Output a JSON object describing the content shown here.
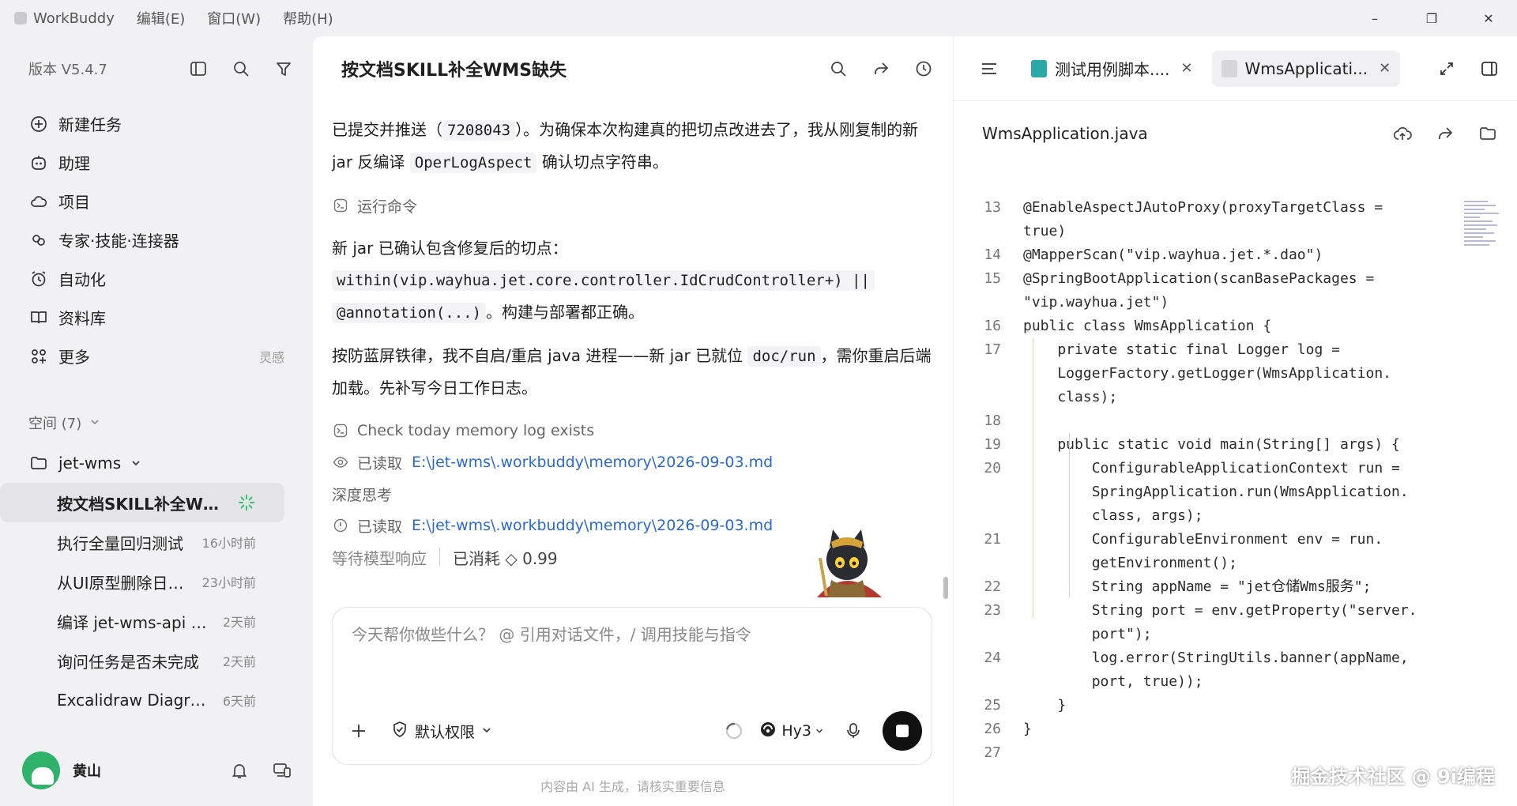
{
  "titlebar": {
    "app_name": "WorkBuddy",
    "menus": [
      "编辑(E)",
      "窗口(W)",
      "帮助(H)"
    ],
    "minimize": "–",
    "restore": "❐",
    "close": "✕"
  },
  "sidebar": {
    "version": "版本 V5.4.7",
    "nav": [
      {
        "label": "新建任务",
        "icon": "plus-circle-icon"
      },
      {
        "label": "助理",
        "icon": "robot-icon"
      },
      {
        "label": "项目",
        "icon": "cloud-icon"
      },
      {
        "label": "专家·技能·连接器",
        "icon": "expert-icon"
      },
      {
        "label": "自动化",
        "icon": "alarm-icon"
      },
      {
        "label": "资料库",
        "icon": "book-icon"
      },
      {
        "label": "更多",
        "icon": "grid-icon",
        "tail": "灵感"
      }
    ],
    "space_label": "空间 (7)",
    "project": "jet-wms",
    "tasks": [
      {
        "label": "按文档SKILL补全WMS...",
        "time": ""
      },
      {
        "label": "执行全量回归测试",
        "time": "16小时前"
      },
      {
        "label": "从UI原型删除日志...",
        "time": "23小时前"
      },
      {
        "label": "编译 jet-wms-api 后...",
        "time": "2天前"
      },
      {
        "label": "询问任务是否未完成",
        "time": "2天前"
      },
      {
        "label": "Excalidraw Diagram ...",
        "time": "6天前"
      }
    ],
    "user": "黄山"
  },
  "chat": {
    "title": "按文档SKILL补全WMS缺失",
    "msg1_a": "已提交并推送（",
    "msg1_commit": "7208043",
    "msg1_b": "）。为确保本次构建真的把切点改进去了，我从刚复制的新 jar 反编译 ",
    "msg1_class": "OperLogAspect",
    "msg1_c": " 确认切点字符串。",
    "step_run": "运行命令",
    "msg2_a": "新 jar 已确认包含修复后的切点：",
    "msg2_code1": "within(vip.wayhua.jet.core.controller.IdCrudController+) ||",
    "msg2_code2": "@annotation(...)",
    "msg2_b": "。构建与部署都正确。",
    "msg3_a": "按防蓝屏铁律，我不自启/重启 java 进程——新 jar 已就位 ",
    "msg3_path": "doc/run",
    "msg3_b": "，需你重启后端加载。先补写今日工作日志。",
    "step_check": "Check today memory log exists",
    "read_label": "已读取",
    "read_path": "E:\\jet-wms\\.workbuddy\\memory\\2026-09-03.md",
    "thinking": "深度思考",
    "waiting": "等待模型响应",
    "cost": "已消耗 ◇ 0.99",
    "composer_placeholder": "今天帮你做些什么？ @ 引用对话文件，/ 调用技能与指令",
    "permission": "默认权限",
    "model": "Hy3",
    "disclaimer": "内容由 AI 生成，请核实重要信息"
  },
  "editor": {
    "tabs": [
      {
        "label": "测试用例脚本....",
        "active": false
      },
      {
        "label": "WmsApplicati...",
        "active": true
      }
    ],
    "file_name": "WmsApplication.java",
    "code": [
      {
        "n": "13",
        "t": "@EnableAspectJAutoProxy(proxyTargetClass ="
      },
      {
        "n": "",
        "t": "true)"
      },
      {
        "n": "14",
        "t": "@MapperScan(\"vip.wayhua.jet.*.dao\")"
      },
      {
        "n": "15",
        "t": "@SpringBootApplication(scanBasePackages ="
      },
      {
        "n": "",
        "t": "\"vip.wayhua.jet\")"
      },
      {
        "n": "16",
        "t": "public class WmsApplication {"
      },
      {
        "n": "17",
        "t": "    private static final Logger log ="
      },
      {
        "n": "",
        "t": "    LoggerFactory.getLogger(WmsApplication."
      },
      {
        "n": "",
        "t": "    class);"
      },
      {
        "n": "18",
        "t": ""
      },
      {
        "n": "19",
        "t": "    public static void main(String[] args) {"
      },
      {
        "n": "20",
        "t": "        ConfigurableApplicationContext run ="
      },
      {
        "n": "",
        "t": "        SpringApplication.run(WmsApplication."
      },
      {
        "n": "",
        "t": "        class, args);"
      },
      {
        "n": "21",
        "t": "        ConfigurableEnvironment env = run."
      },
      {
        "n": "",
        "t": "        getEnvironment();"
      },
      {
        "n": "22",
        "t": "        String appName = \"jet仓储Wms服务\";"
      },
      {
        "n": "23",
        "t": "        String port = env.getProperty(\"server."
      },
      {
        "n": "",
        "t": "        port\");"
      },
      {
        "n": "24",
        "t": "        log.error(StringUtils.banner(appName,"
      },
      {
        "n": "",
        "t": "        port, true));"
      },
      {
        "n": "25",
        "t": "    }"
      },
      {
        "n": "26",
        "t": "}"
      },
      {
        "n": "27",
        "t": ""
      }
    ]
  },
  "watermark": "掘金技术社区 @ 9i编程"
}
